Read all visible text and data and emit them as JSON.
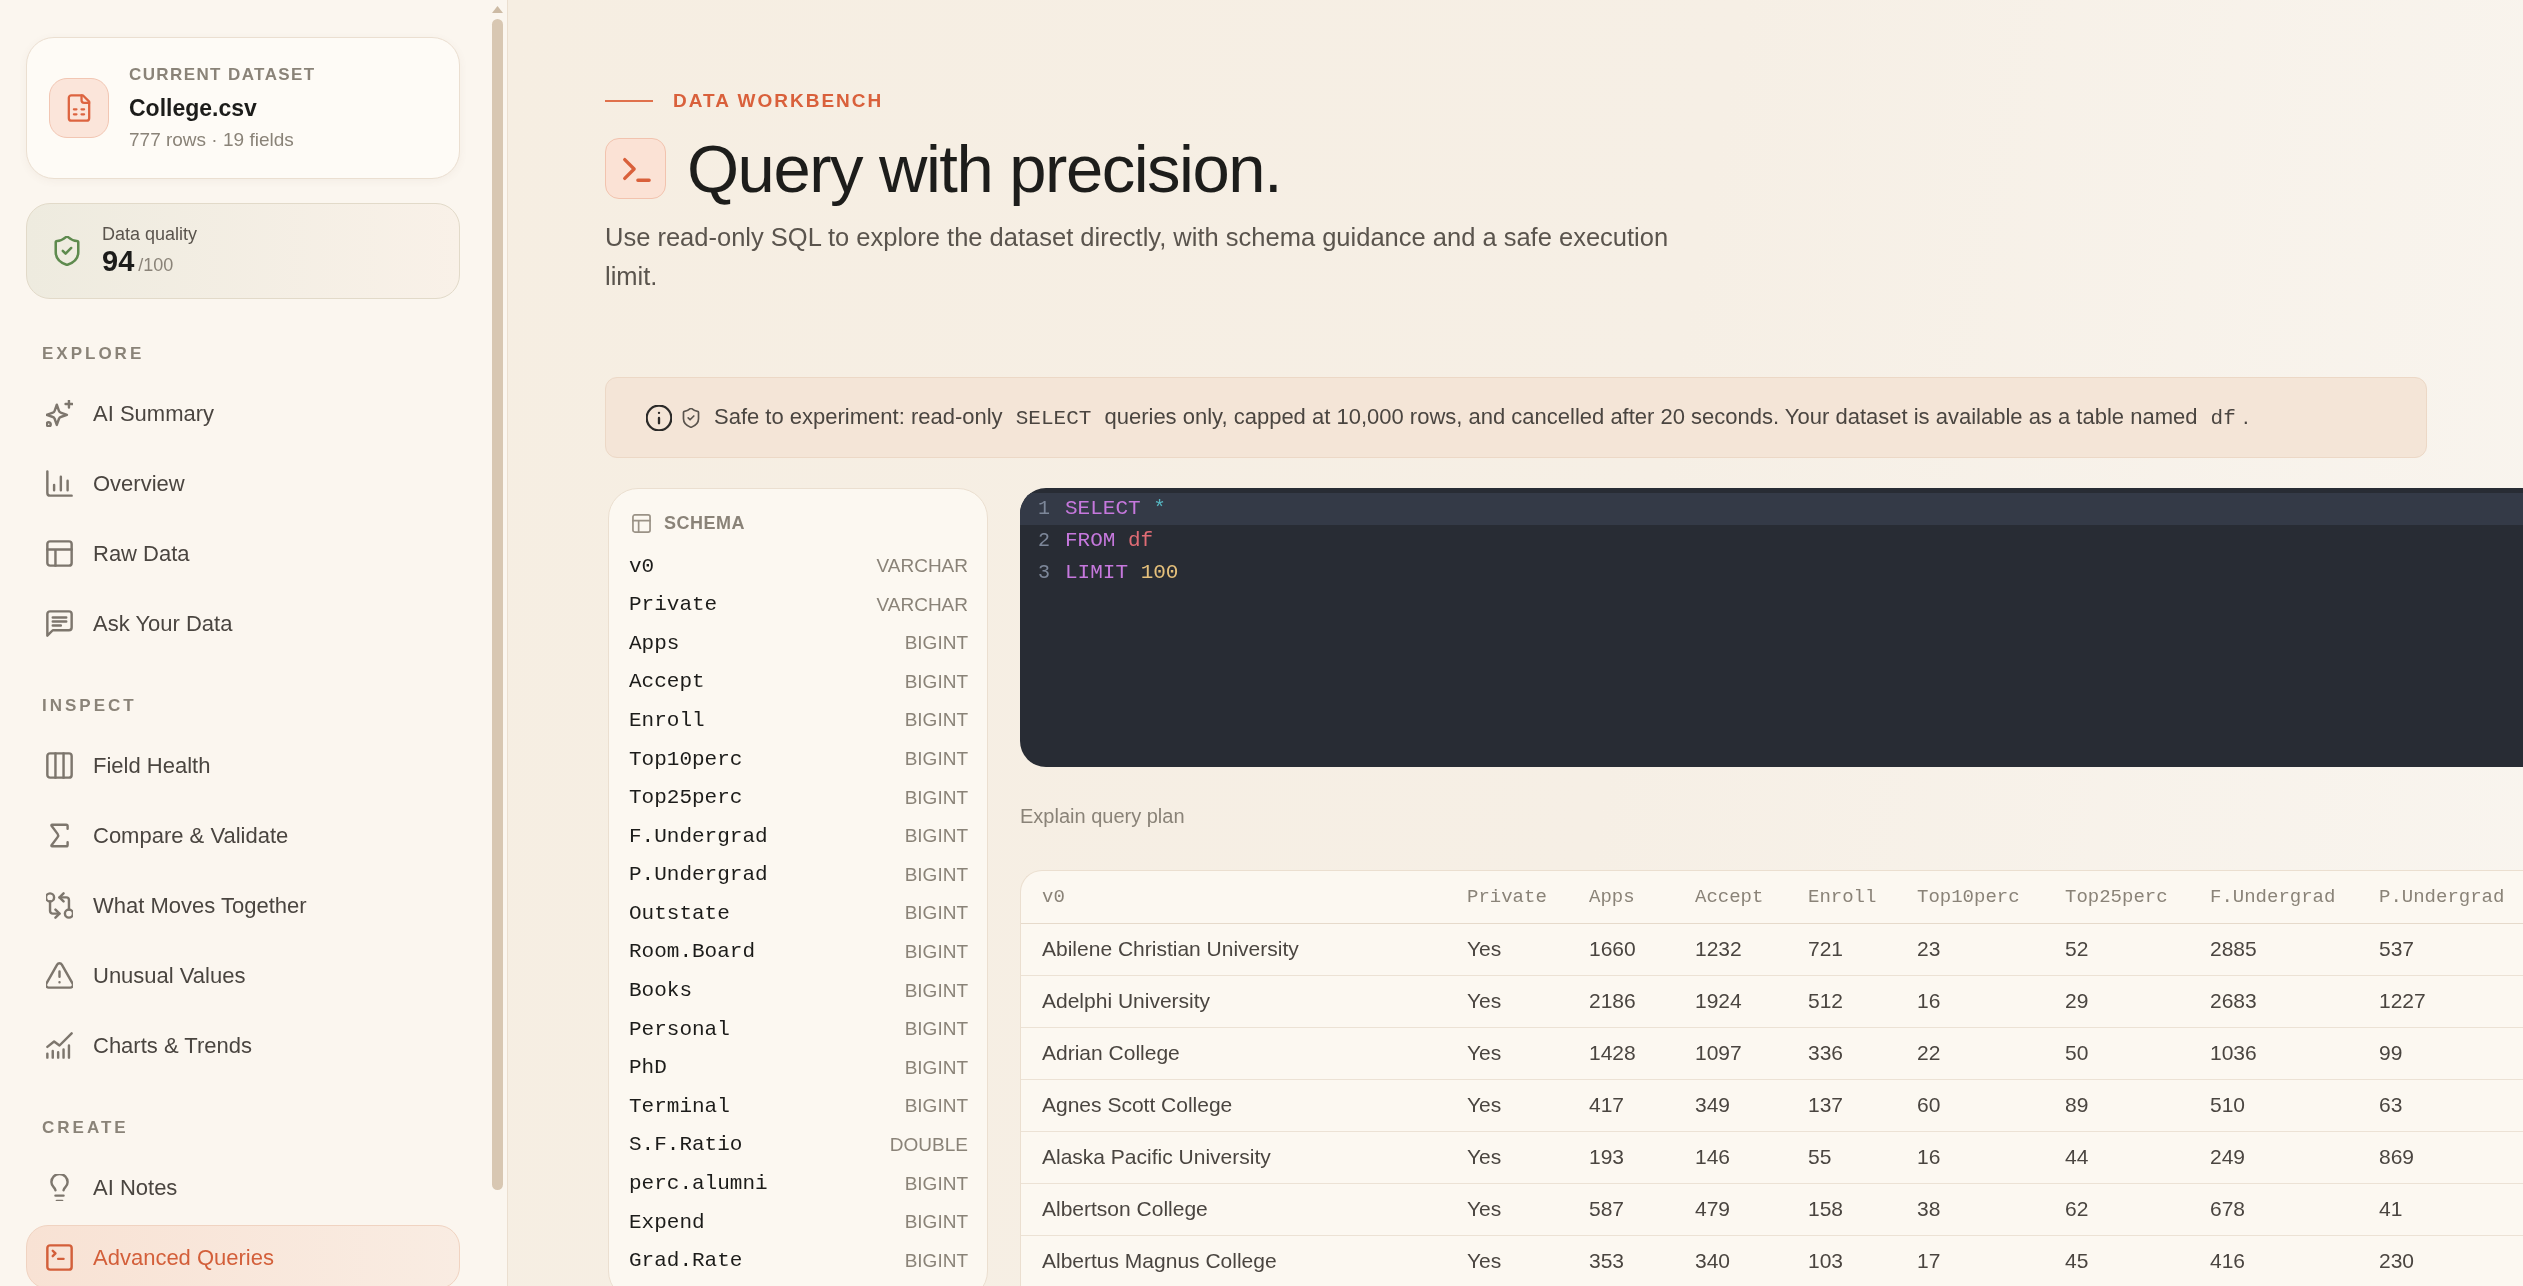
{
  "sidebar": {
    "dataset_card": {
      "label": "CURRENT DATASET",
      "name": "College.csv",
      "meta": "777 rows · 19 fields"
    },
    "quality_card": {
      "label": "Data quality",
      "score": "94",
      "max": "/100"
    },
    "sections": [
      {
        "heading": "EXPLORE",
        "items": [
          {
            "label": "AI Summary",
            "selected": false
          },
          {
            "label": "Overview",
            "selected": false
          },
          {
            "label": "Raw Data",
            "selected": false
          },
          {
            "label": "Ask Your Data",
            "selected": false
          }
        ]
      },
      {
        "heading": "INSPECT",
        "items": [
          {
            "label": "Field Health",
            "selected": false
          },
          {
            "label": "Compare & Validate",
            "selected": false
          },
          {
            "label": "What Moves Together",
            "selected": false
          },
          {
            "label": "Unusual Values",
            "selected": false
          },
          {
            "label": "Charts & Trends",
            "selected": false
          }
        ]
      },
      {
        "heading": "CREATE",
        "items": [
          {
            "label": "AI Notes",
            "selected": false
          },
          {
            "label": "Advanced Queries",
            "selected": true
          }
        ]
      }
    ]
  },
  "header": {
    "eyebrow": "DATA WORKBENCH",
    "title": "Query with precision.",
    "description": "Use read-only SQL to explore the dataset directly, with schema guidance and a safe execution limit."
  },
  "notice": {
    "parts": [
      {
        "kind": "text",
        "text": "Safe to experiment: read-only "
      },
      {
        "kind": "code",
        "text": "SELECT"
      },
      {
        "kind": "text",
        "text": " queries only, capped at 10,000 rows, and cancelled after 20 seconds. Your dataset is available as a table named "
      },
      {
        "kind": "code",
        "text": "df"
      },
      {
        "kind": "text",
        "text": "."
      }
    ]
  },
  "schema": {
    "title": "SCHEMA",
    "fields": [
      {
        "name": "v0",
        "type": "VARCHAR"
      },
      {
        "name": "Private",
        "type": "VARCHAR"
      },
      {
        "name": "Apps",
        "type": "BIGINT"
      },
      {
        "name": "Accept",
        "type": "BIGINT"
      },
      {
        "name": "Enroll",
        "type": "BIGINT"
      },
      {
        "name": "Top10perc",
        "type": "BIGINT"
      },
      {
        "name": "Top25perc",
        "type": "BIGINT"
      },
      {
        "name": "F.Undergrad",
        "type": "BIGINT"
      },
      {
        "name": "P.Undergrad",
        "type": "BIGINT"
      },
      {
        "name": "Outstate",
        "type": "BIGINT"
      },
      {
        "name": "Room.Board",
        "type": "BIGINT"
      },
      {
        "name": "Books",
        "type": "BIGINT"
      },
      {
        "name": "Personal",
        "type": "BIGINT"
      },
      {
        "name": "PhD",
        "type": "BIGINT"
      },
      {
        "name": "Terminal",
        "type": "BIGINT"
      },
      {
        "name": "S.F.Ratio",
        "type": "DOUBLE"
      },
      {
        "name": "perc.alumni",
        "type": "BIGINT"
      },
      {
        "name": "Expend",
        "type": "BIGINT"
      },
      {
        "name": "Grad.Rate",
        "type": "BIGINT"
      }
    ]
  },
  "editor": {
    "lines": [
      {
        "number": "1",
        "active": true,
        "tokens": [
          {
            "kind": "keyword",
            "text": "SELECT "
          },
          {
            "kind": "operator",
            "text": "*"
          }
        ]
      },
      {
        "number": "2",
        "active": false,
        "tokens": [
          {
            "kind": "keyword",
            "text": "FROM "
          },
          {
            "kind": "identifier",
            "text": "df"
          }
        ]
      },
      {
        "number": "3",
        "active": false,
        "tokens": [
          {
            "kind": "keyword",
            "text": "LIMIT "
          },
          {
            "kind": "number",
            "text": "100"
          }
        ]
      }
    ]
  },
  "explain_link": "Explain query plan",
  "results": {
    "columns": [
      "v0",
      "Private",
      "Apps",
      "Accept",
      "Enroll",
      "Top10perc",
      "Top25perc",
      "F.Undergrad",
      "P.Undergrad"
    ],
    "rows": [
      [
        "Abilene Christian University",
        "Yes",
        "1660",
        "1232",
        "721",
        "23",
        "52",
        "2885",
        "537"
      ],
      [
        "Adelphi University",
        "Yes",
        "2186",
        "1924",
        "512",
        "16",
        "29",
        "2683",
        "1227"
      ],
      [
        "Adrian College",
        "Yes",
        "1428",
        "1097",
        "336",
        "22",
        "50",
        "1036",
        "99"
      ],
      [
        "Agnes Scott College",
        "Yes",
        "417",
        "349",
        "137",
        "60",
        "89",
        "510",
        "63"
      ],
      [
        "Alaska Pacific University",
        "Yes",
        "193",
        "146",
        "55",
        "16",
        "44",
        "249",
        "869"
      ],
      [
        "Albertson College",
        "Yes",
        "587",
        "479",
        "158",
        "38",
        "62",
        "678",
        "41"
      ],
      [
        "Albertus Magnus College",
        "Yes",
        "353",
        "340",
        "103",
        "17",
        "45",
        "416",
        "230"
      ]
    ]
  }
}
